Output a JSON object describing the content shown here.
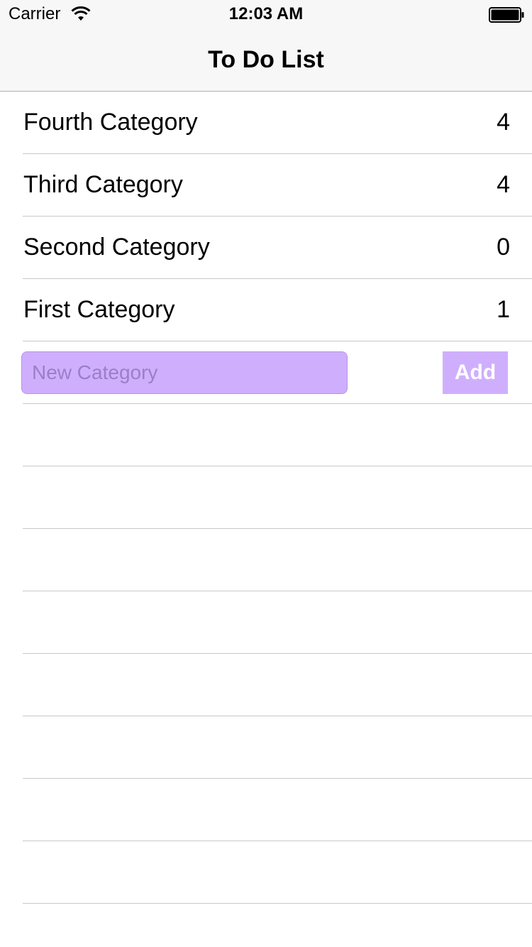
{
  "status_bar": {
    "carrier": "Carrier",
    "time": "12:03 AM",
    "wifi_icon": "wifi-icon",
    "battery_icon": "battery-full-icon"
  },
  "nav": {
    "title": "To Do List"
  },
  "categories": [
    {
      "name": "Fourth Category",
      "count": "4"
    },
    {
      "name": "Third Category",
      "count": "4"
    },
    {
      "name": "Second Category",
      "count": "0"
    },
    {
      "name": "First Category",
      "count": "1"
    }
  ],
  "new_category": {
    "placeholder": "New Category",
    "value": "",
    "add_label": "Add"
  },
  "colors": {
    "accent": "#cfaffd",
    "nav_background": "#f7f7f7",
    "separator": "#c8c7cc"
  }
}
